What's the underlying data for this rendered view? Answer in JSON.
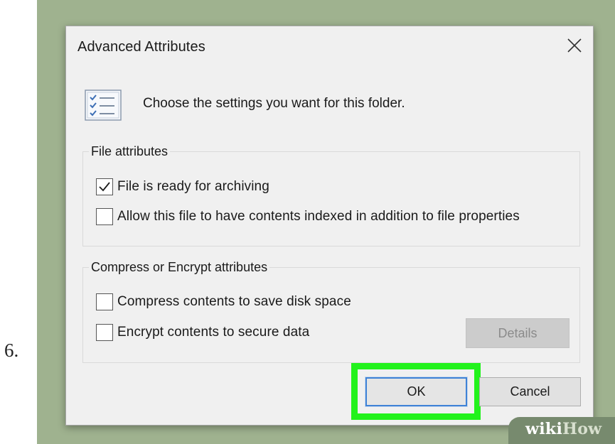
{
  "step": {
    "number": "6."
  },
  "dialog": {
    "title": "Advanced Attributes",
    "close_icon": "close-icon",
    "header_text": "Choose the settings you want for this folder.",
    "header_icon": "checklist-icon"
  },
  "file_attributes": {
    "legend": "File attributes",
    "archive": {
      "label": "File is ready for archiving",
      "checked": true
    },
    "index": {
      "label": "Allow this file to have contents indexed in addition to file properties",
      "checked": false
    }
  },
  "compress_encrypt": {
    "legend": "Compress or Encrypt attributes",
    "compress": {
      "label": "Compress contents to save disk space",
      "checked": false
    },
    "encrypt": {
      "label": "Encrypt contents to secure data",
      "checked": false
    },
    "details_label": "Details",
    "details_enabled": false
  },
  "buttons": {
    "ok": "OK",
    "cancel": "Cancel"
  },
  "highlight": {
    "target": "ok",
    "color": "#22f21c"
  },
  "watermark": {
    "part1": "wiki",
    "part2": "How"
  },
  "colors": {
    "backdrop": "#9fb28f",
    "dialog_bg": "#f0f0f0",
    "focus_border": "#3f82d6"
  }
}
